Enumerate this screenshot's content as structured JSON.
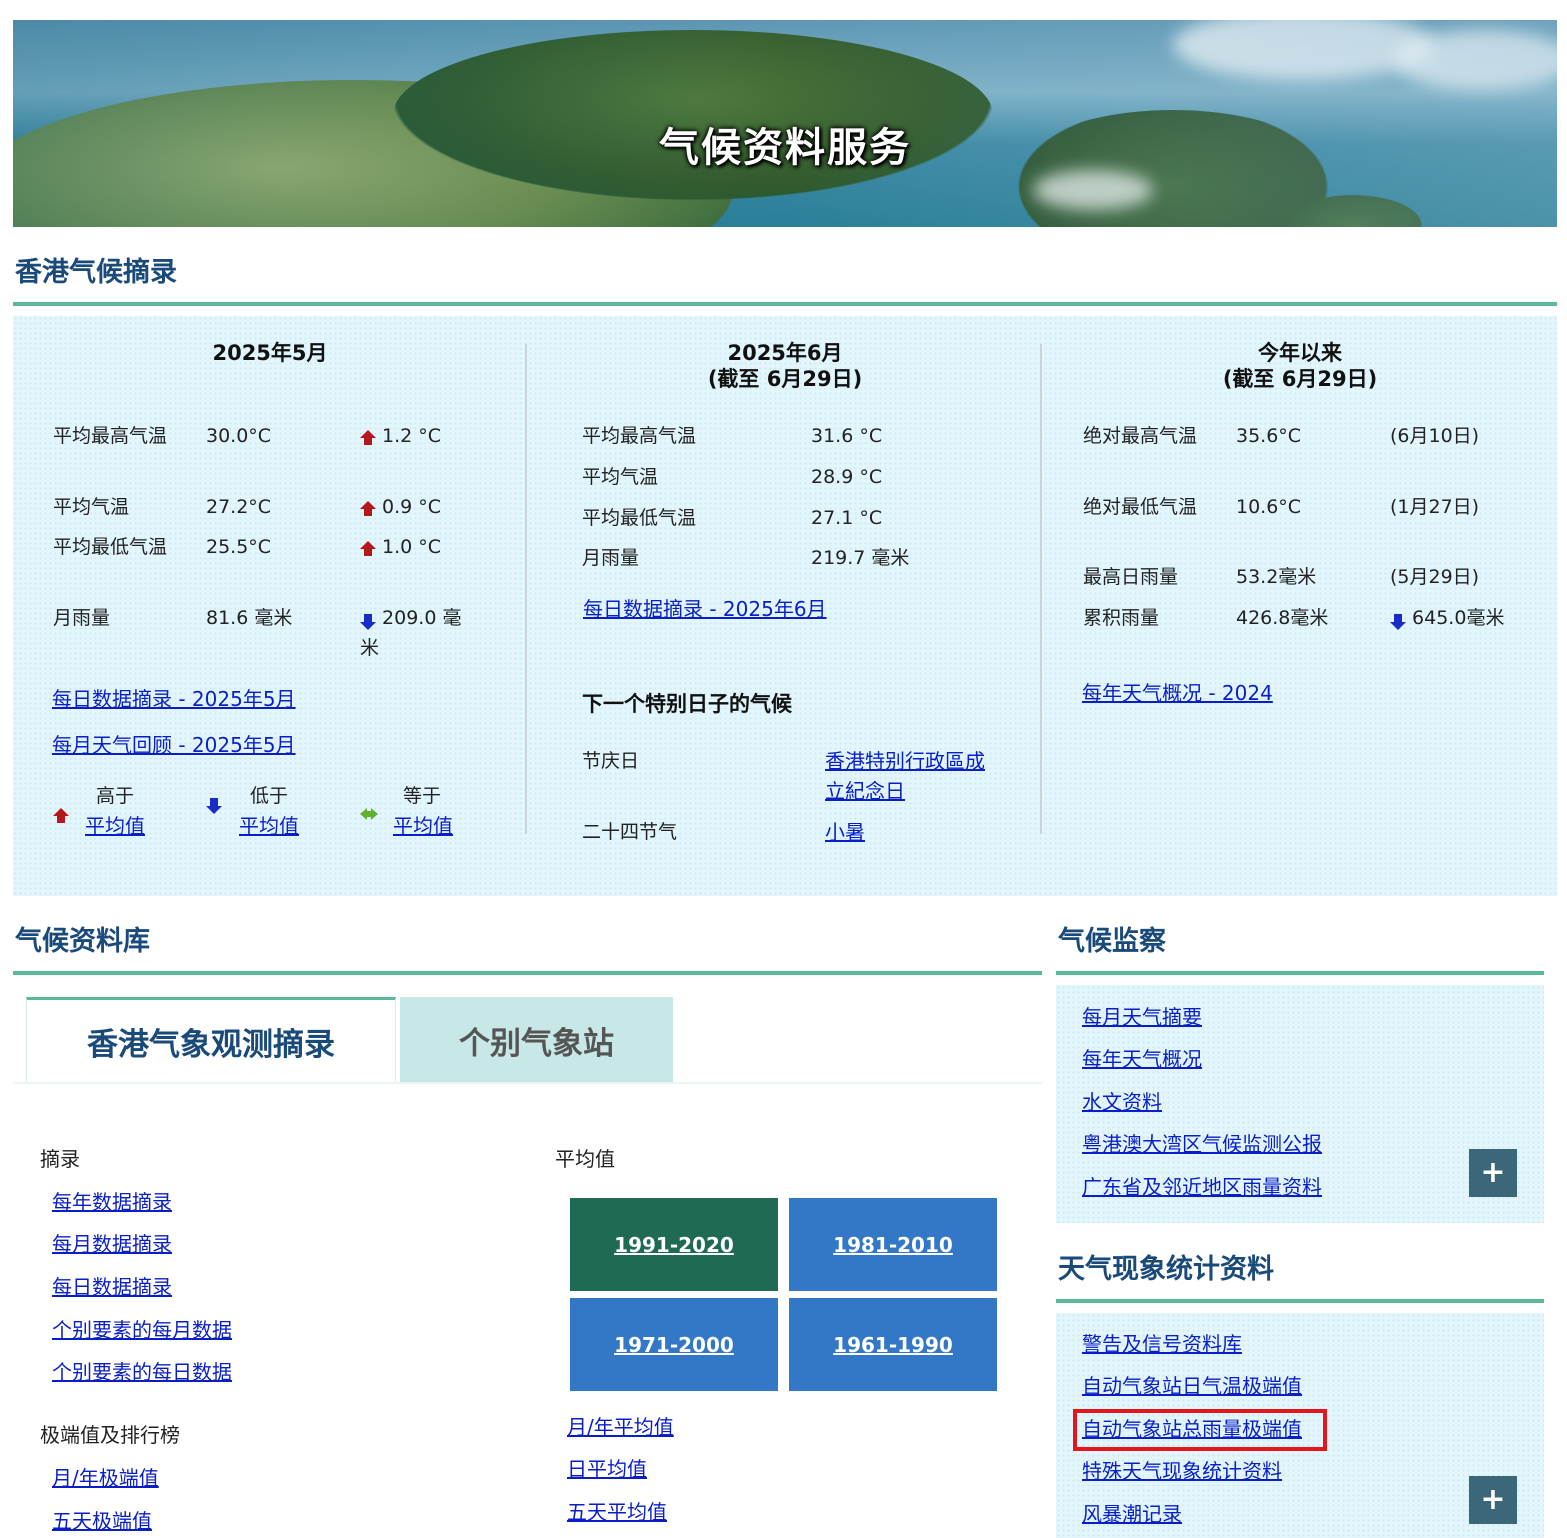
{
  "banner": {
    "title": "气候资料服务"
  },
  "summary": {
    "title": "香港气候摘录",
    "may": {
      "heading": "2025年5月",
      "rows": [
        {
          "label": "平均最高气温",
          "value": "30.0°C",
          "diff": "1.2 °C",
          "dir": "up"
        },
        {
          "label": "平均气温",
          "value": "27.2°C",
          "diff": "0.9 °C",
          "dir": "up"
        },
        {
          "label": "平均最低气温",
          "value": "25.5°C",
          "diff": "1.0 °C",
          "dir": "up"
        },
        {
          "label": "月雨量",
          "value": "81.6 毫米",
          "diff": "209.0 毫米",
          "dir": "down"
        }
      ],
      "links": [
        "每日数据摘录 - 2025年5月",
        "每月天气回顾 - 2025年5月"
      ],
      "legend": [
        {
          "label": "高于",
          "link": "平均值"
        },
        {
          "label": "低于",
          "link": "平均值"
        },
        {
          "label": "等于",
          "link": "平均值"
        }
      ]
    },
    "june": {
      "heading1": "2025年6月",
      "heading2": "(截至 6月29日)",
      "rows": [
        {
          "label": "平均最高气温",
          "value": "31.6 °C"
        },
        {
          "label": "平均气温",
          "value": "28.9 °C"
        },
        {
          "label": "平均最低气温",
          "value": "27.1 °C"
        },
        {
          "label": "月雨量",
          "value": "219.7 毫米"
        }
      ],
      "link": "每日数据摘录 - 2025年6月",
      "special_title": "下一个特别日子的气候",
      "special": [
        {
          "label": "节庆日",
          "link": "香港特别行政區成立紀念日"
        },
        {
          "label": "二十四节气",
          "link": "小暑"
        }
      ]
    },
    "ytd": {
      "heading1": "今年以来",
      "heading2": "(截至 6月29日)",
      "rows": [
        {
          "label": "绝对最高气温",
          "value": "35.6°C",
          "extra": "(6月10日)"
        },
        {
          "label": "绝对最低气温",
          "value": "10.6°C",
          "extra": "(1月27日)"
        },
        {
          "label": "最高日雨量",
          "value": "53.2毫米",
          "extra": "(5月29日)"
        },
        {
          "label": "累积雨量",
          "value": "426.8毫米",
          "extra": "645.0毫米",
          "dir": "down"
        }
      ],
      "link": "每年天气概况 - 2024"
    }
  },
  "database": {
    "title": "气候资料库",
    "tabs": [
      "香港气象观测摘录",
      "个别气象站"
    ],
    "summaries_head": "摘录",
    "summaries": [
      "每年数据摘录",
      "每月数据摘录",
      "每日数据摘录",
      "个别要素的每月数据",
      "个别要素的每日数据"
    ],
    "extremes_head": "极端值及排行榜",
    "extremes": [
      "月/年极端值",
      "五天极端值"
    ],
    "normals_head": "平均值",
    "normals": [
      "1991-2020",
      "1981-2010",
      "1971-2000",
      "1961-1990"
    ],
    "normals_links": [
      "月/年平均值",
      "日平均值",
      "五天平均值"
    ]
  },
  "monitoring": {
    "title": "气候监察",
    "links": [
      "每月天气摘要",
      "每年天气概况",
      "水文资料",
      "粤港澳大湾区气候监测公报",
      "广东省及邻近地区雨量资料"
    ],
    "more": "+"
  },
  "phenomena": {
    "title": "天气现象统计资料",
    "links": [
      "警告及信号资料库",
      "自动气象站日气温极端值",
      "自动气象站总雨量极端值",
      "特殊天气现象统计资料",
      "风暴潮记录"
    ],
    "more": "+"
  },
  "colors": {
    "heading": "#1a4a7a",
    "rule": "#5cb89a",
    "panel": "#e4f6fc",
    "link": "#0a1ec8",
    "highlight": "#e3161d"
  }
}
